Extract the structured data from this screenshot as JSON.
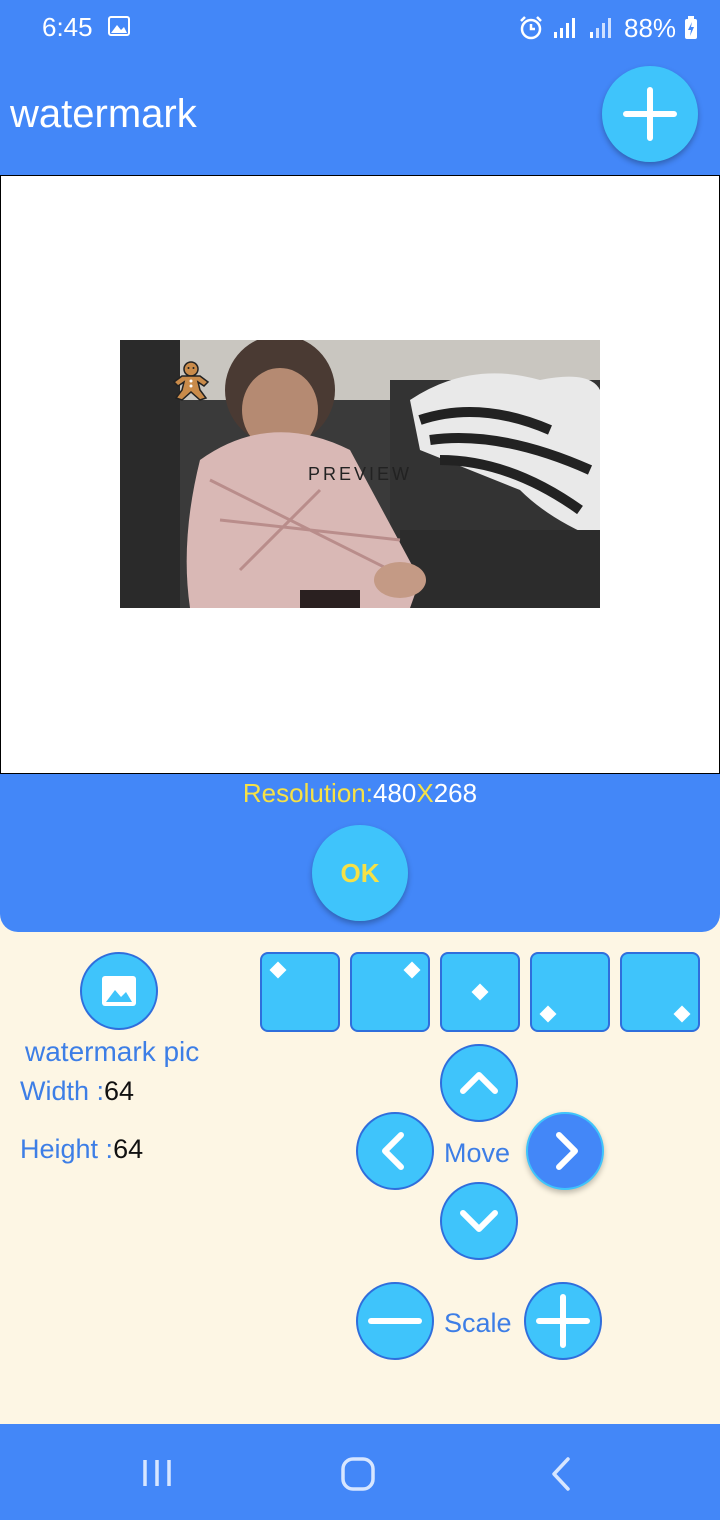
{
  "status_bar": {
    "time": "6:45",
    "battery": "88%"
  },
  "app_bar": {
    "title": "watermark"
  },
  "preview": {
    "label": "PREVIEW"
  },
  "resolution": {
    "prefix": "Resolution:",
    "width": "480",
    "sep": "X",
    "height": "268"
  },
  "ok_label": "OK",
  "watermark": {
    "pic_label": "watermark pic",
    "width_label": "Width :",
    "width_value": "64",
    "height_label": "Height :",
    "height_value": "64"
  },
  "controls": {
    "move_label": "Move",
    "scale_label": "Scale"
  },
  "icons": [
    "image-icon",
    "plus-icon",
    "chevron-up-icon",
    "chevron-down-icon",
    "chevron-left-icon",
    "chevron-right-icon",
    "minus-icon",
    "gingerbread-icon",
    "recents-icon",
    "home-icon",
    "back-icon"
  ],
  "colors": {
    "primary": "#4387f8",
    "accent": "#3fc4fb",
    "panel_bg": "#fdf6e4",
    "highlight": "#f6e146"
  }
}
